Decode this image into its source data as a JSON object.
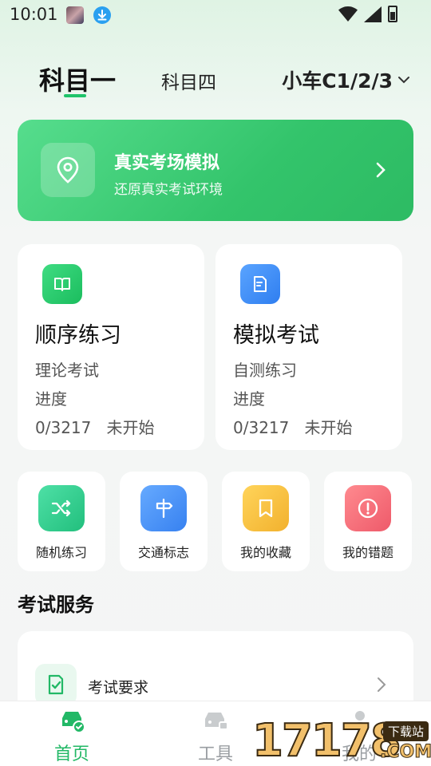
{
  "status_bar": {
    "time": "10:01"
  },
  "tabs": {
    "subject_one": "科目一",
    "subject_four": "科目四",
    "license": "小车C1/2/3"
  },
  "banner": {
    "title": "真实考场模拟",
    "subtitle": "还原真实考试环境"
  },
  "cards": [
    {
      "title": "顺序练习",
      "line1": "理论考试",
      "line2": "进度",
      "progress": "0/3217",
      "status": "未开始"
    },
    {
      "title": "模拟考试",
      "line1": "自测练习",
      "line2": "进度",
      "progress": "0/3217",
      "status": "未开始"
    }
  ],
  "tools": [
    {
      "label": "随机练习",
      "icon": "shuffle-icon"
    },
    {
      "label": "交通标志",
      "icon": "signpost-icon"
    },
    {
      "label": "我的收藏",
      "icon": "bookmark-icon"
    },
    {
      "label": "我的错题",
      "icon": "alert-icon"
    }
  ],
  "section": {
    "title": "考试服务"
  },
  "services": [
    {
      "label": "考试要求"
    }
  ],
  "bottom_nav": [
    {
      "label": "首页"
    },
    {
      "label": "工具"
    },
    {
      "label": "我的"
    }
  ],
  "watermark": {
    "digits": "17178",
    "tag": "下载站",
    "com": ".COM"
  },
  "colors": {
    "accent": "#1fc46a",
    "blue": "#3f8cf5",
    "yellow": "#f5c442",
    "red": "#f36a77"
  }
}
